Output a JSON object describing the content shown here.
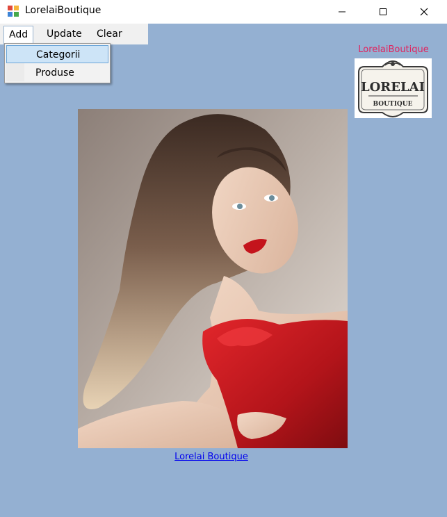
{
  "window": {
    "title": "LorelaiBoutique",
    "icons": {
      "app": "app-icon",
      "minimize": "minimize-icon",
      "maximize": "maximize-icon",
      "close": "close-icon"
    }
  },
  "menu": {
    "items": [
      {
        "label": "Add",
        "open": true
      },
      {
        "label": "Update",
        "open": false
      },
      {
        "label": "Clear",
        "open": false
      }
    ],
    "dropdown": [
      {
        "label": "Categorii",
        "highlighted": true
      },
      {
        "label": "Produse",
        "highlighted": false
      }
    ]
  },
  "brand": {
    "caption": "LorelaiBoutique",
    "logo_text": "LORELAI",
    "logo_subtext": "BOUTIQUE",
    "caption_color": "#e0245e"
  },
  "main": {
    "link_text": "Lorelai Boutique",
    "background_color": "#94b0d2"
  }
}
